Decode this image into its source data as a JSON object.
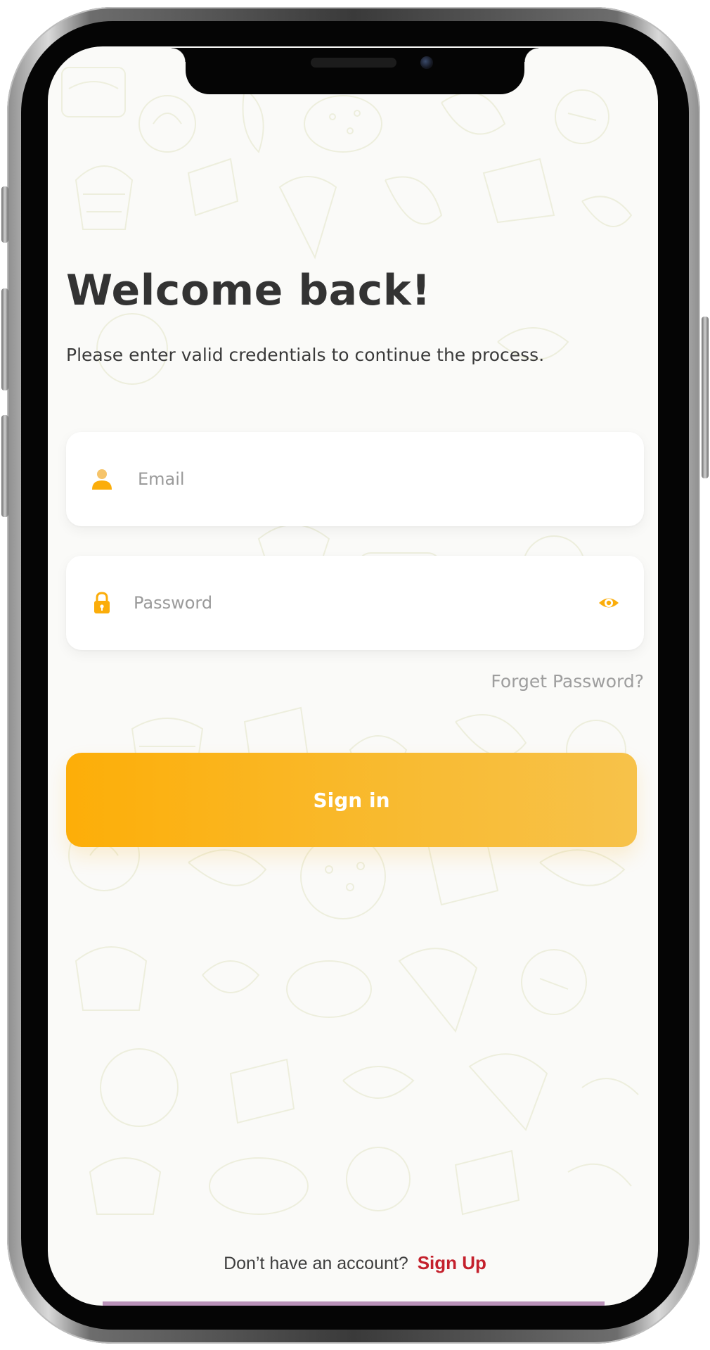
{
  "login": {
    "title": "Welcome back!",
    "subtitle": "Please enter valid credentials to continue the process.",
    "email": {
      "placeholder": "Email",
      "value": "",
      "icon": "user-icon"
    },
    "password": {
      "placeholder": "Password",
      "value": "",
      "icon": "lock-icon",
      "toggle_icon": "eye-icon"
    },
    "forgot_label": "Forget Password?",
    "signin_label": "Sign in"
  },
  "footer": {
    "prompt": "Don’t have an account?",
    "signup_label": "Sign Up"
  },
  "colors": {
    "accent": "#FDAE08",
    "accent_light": "#F7C24A",
    "signup_link": "#C4202C",
    "title_text": "#333333",
    "placeholder": "#9A9A9A"
  }
}
